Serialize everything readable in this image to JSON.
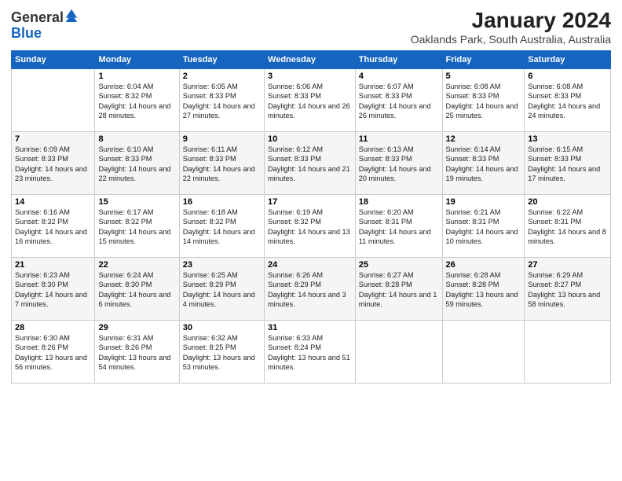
{
  "logo": {
    "line1": "General",
    "line2": "Blue"
  },
  "title": "January 2024",
  "subtitle": "Oaklands Park, South Australia, Australia",
  "headers": [
    "Sunday",
    "Monday",
    "Tuesday",
    "Wednesday",
    "Thursday",
    "Friday",
    "Saturday"
  ],
  "weeks": [
    [
      {
        "num": "",
        "sunrise": "",
        "sunset": "",
        "daylight": ""
      },
      {
        "num": "1",
        "sunrise": "Sunrise: 6:04 AM",
        "sunset": "Sunset: 8:32 PM",
        "daylight": "Daylight: 14 hours and 28 minutes."
      },
      {
        "num": "2",
        "sunrise": "Sunrise: 6:05 AM",
        "sunset": "Sunset: 8:33 PM",
        "daylight": "Daylight: 14 hours and 27 minutes."
      },
      {
        "num": "3",
        "sunrise": "Sunrise: 6:06 AM",
        "sunset": "Sunset: 8:33 PM",
        "daylight": "Daylight: 14 hours and 26 minutes."
      },
      {
        "num": "4",
        "sunrise": "Sunrise: 6:07 AM",
        "sunset": "Sunset: 8:33 PM",
        "daylight": "Daylight: 14 hours and 26 minutes."
      },
      {
        "num": "5",
        "sunrise": "Sunrise: 6:08 AM",
        "sunset": "Sunset: 8:33 PM",
        "daylight": "Daylight: 14 hours and 25 minutes."
      },
      {
        "num": "6",
        "sunrise": "Sunrise: 6:08 AM",
        "sunset": "Sunset: 8:33 PM",
        "daylight": "Daylight: 14 hours and 24 minutes."
      }
    ],
    [
      {
        "num": "7",
        "sunrise": "Sunrise: 6:09 AM",
        "sunset": "Sunset: 8:33 PM",
        "daylight": "Daylight: 14 hours and 23 minutes."
      },
      {
        "num": "8",
        "sunrise": "Sunrise: 6:10 AM",
        "sunset": "Sunset: 8:33 PM",
        "daylight": "Daylight: 14 hours and 22 minutes."
      },
      {
        "num": "9",
        "sunrise": "Sunrise: 6:11 AM",
        "sunset": "Sunset: 8:33 PM",
        "daylight": "Daylight: 14 hours and 22 minutes."
      },
      {
        "num": "10",
        "sunrise": "Sunrise: 6:12 AM",
        "sunset": "Sunset: 8:33 PM",
        "daylight": "Daylight: 14 hours and 21 minutes."
      },
      {
        "num": "11",
        "sunrise": "Sunrise: 6:13 AM",
        "sunset": "Sunset: 8:33 PM",
        "daylight": "Daylight: 14 hours and 20 minutes."
      },
      {
        "num": "12",
        "sunrise": "Sunrise: 6:14 AM",
        "sunset": "Sunset: 8:33 PM",
        "daylight": "Daylight: 14 hours and 19 minutes."
      },
      {
        "num": "13",
        "sunrise": "Sunrise: 6:15 AM",
        "sunset": "Sunset: 8:33 PM",
        "daylight": "Daylight: 14 hours and 17 minutes."
      }
    ],
    [
      {
        "num": "14",
        "sunrise": "Sunrise: 6:16 AM",
        "sunset": "Sunset: 8:32 PM",
        "daylight": "Daylight: 14 hours and 16 minutes."
      },
      {
        "num": "15",
        "sunrise": "Sunrise: 6:17 AM",
        "sunset": "Sunset: 8:32 PM",
        "daylight": "Daylight: 14 hours and 15 minutes."
      },
      {
        "num": "16",
        "sunrise": "Sunrise: 6:18 AM",
        "sunset": "Sunset: 8:32 PM",
        "daylight": "Daylight: 14 hours and 14 minutes."
      },
      {
        "num": "17",
        "sunrise": "Sunrise: 6:19 AM",
        "sunset": "Sunset: 8:32 PM",
        "daylight": "Daylight: 14 hours and 13 minutes."
      },
      {
        "num": "18",
        "sunrise": "Sunrise: 6:20 AM",
        "sunset": "Sunset: 8:31 PM",
        "daylight": "Daylight: 14 hours and 11 minutes."
      },
      {
        "num": "19",
        "sunrise": "Sunrise: 6:21 AM",
        "sunset": "Sunset: 8:31 PM",
        "daylight": "Daylight: 14 hours and 10 minutes."
      },
      {
        "num": "20",
        "sunrise": "Sunrise: 6:22 AM",
        "sunset": "Sunset: 8:31 PM",
        "daylight": "Daylight: 14 hours and 8 minutes."
      }
    ],
    [
      {
        "num": "21",
        "sunrise": "Sunrise: 6:23 AM",
        "sunset": "Sunset: 8:30 PM",
        "daylight": "Daylight: 14 hours and 7 minutes."
      },
      {
        "num": "22",
        "sunrise": "Sunrise: 6:24 AM",
        "sunset": "Sunset: 8:30 PM",
        "daylight": "Daylight: 14 hours and 6 minutes."
      },
      {
        "num": "23",
        "sunrise": "Sunrise: 6:25 AM",
        "sunset": "Sunset: 8:29 PM",
        "daylight": "Daylight: 14 hours and 4 minutes."
      },
      {
        "num": "24",
        "sunrise": "Sunrise: 6:26 AM",
        "sunset": "Sunset: 8:29 PM",
        "daylight": "Daylight: 14 hours and 3 minutes."
      },
      {
        "num": "25",
        "sunrise": "Sunrise: 6:27 AM",
        "sunset": "Sunset: 8:28 PM",
        "daylight": "Daylight: 14 hours and 1 minute."
      },
      {
        "num": "26",
        "sunrise": "Sunrise: 6:28 AM",
        "sunset": "Sunset: 8:28 PM",
        "daylight": "Daylight: 13 hours and 59 minutes."
      },
      {
        "num": "27",
        "sunrise": "Sunrise: 6:29 AM",
        "sunset": "Sunset: 8:27 PM",
        "daylight": "Daylight: 13 hours and 58 minutes."
      }
    ],
    [
      {
        "num": "28",
        "sunrise": "Sunrise: 6:30 AM",
        "sunset": "Sunset: 8:26 PM",
        "daylight": "Daylight: 13 hours and 56 minutes."
      },
      {
        "num": "29",
        "sunrise": "Sunrise: 6:31 AM",
        "sunset": "Sunset: 8:26 PM",
        "daylight": "Daylight: 13 hours and 54 minutes."
      },
      {
        "num": "30",
        "sunrise": "Sunrise: 6:32 AM",
        "sunset": "Sunset: 8:25 PM",
        "daylight": "Daylight: 13 hours and 53 minutes."
      },
      {
        "num": "31",
        "sunrise": "Sunrise: 6:33 AM",
        "sunset": "Sunset: 8:24 PM",
        "daylight": "Daylight: 13 hours and 51 minutes."
      },
      {
        "num": "",
        "sunrise": "",
        "sunset": "",
        "daylight": ""
      },
      {
        "num": "",
        "sunrise": "",
        "sunset": "",
        "daylight": ""
      },
      {
        "num": "",
        "sunrise": "",
        "sunset": "",
        "daylight": ""
      }
    ]
  ]
}
